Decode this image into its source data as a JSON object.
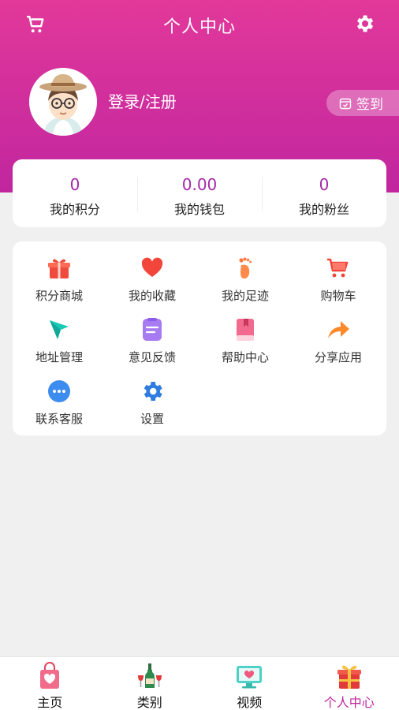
{
  "header": {
    "title": "个人中心",
    "left_icon": "cart-icon",
    "right_icon": "gear-icon",
    "gradient": [
      "#e2389a",
      "#c1269f"
    ]
  },
  "profile": {
    "login_label": "登录/注册",
    "signin_label": "签到"
  },
  "stats": [
    {
      "value": "0",
      "label": "我的积分"
    },
    {
      "value": "0.00",
      "label": "我的钱包"
    },
    {
      "value": "0",
      "label": "我的粉丝"
    }
  ],
  "menu": [
    {
      "label": "积分商城",
      "icon": "gift-icon"
    },
    {
      "label": "我的收藏",
      "icon": "heart-icon"
    },
    {
      "label": "我的足迹",
      "icon": "footprint-icon"
    },
    {
      "label": "购物车",
      "icon": "shopping-cart-icon"
    },
    {
      "label": "地址管理",
      "icon": "compass-icon"
    },
    {
      "label": "意见反馈",
      "icon": "feedback-icon"
    },
    {
      "label": "帮助中心",
      "icon": "book-icon"
    },
    {
      "label": "分享应用",
      "icon": "share-icon"
    },
    {
      "label": "联系客服",
      "icon": "chat-icon"
    },
    {
      "label": "设置",
      "icon": "settings-icon"
    }
  ],
  "tabs": [
    {
      "label": "主页",
      "icon": "shopping-bag-icon",
      "active": false
    },
    {
      "label": "类别",
      "icon": "wine-icon",
      "active": false
    },
    {
      "label": "视频",
      "icon": "monitor-icon",
      "active": false
    },
    {
      "label": "个人中心",
      "icon": "gift-box-icon",
      "active": true
    }
  ],
  "colors": {
    "accent": "#c1269f",
    "stat_value": "#a32aa6",
    "page_bg": "#f0f0f0"
  }
}
